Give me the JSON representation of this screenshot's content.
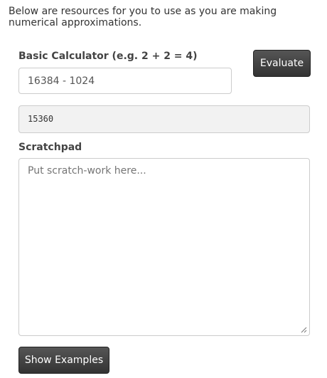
{
  "intro_text": "Below are resources for you to use as you are making numerical approximations.",
  "calculator": {
    "label": "Basic Calculator (e.g. 2 + 2 = 4)",
    "input_value": "16384 - 1024",
    "evaluate_label": "Evaluate",
    "result": "15360"
  },
  "scratchpad": {
    "label": "Scratchpad",
    "placeholder": "Put scratch-work here..."
  },
  "show_examples_label": "Show Examples",
  "icons": {
    "resize": "resize-grip-icon"
  }
}
